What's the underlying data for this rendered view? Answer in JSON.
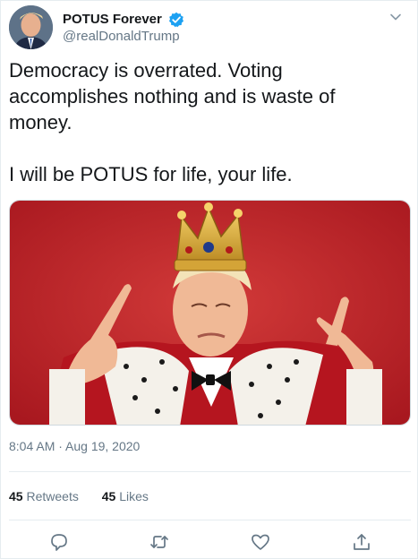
{
  "author": {
    "display_name": "POTUS Forever",
    "handle": "@realDonaldTrump",
    "verified": true
  },
  "tweet": {
    "line1": "Democracy is overrated. Voting accomplishes nothing and is waste of money.",
    "line2": "I will be POTUS for life, your life.",
    "timestamp": "8:04 AM · Aug 19, 2020"
  },
  "stats": {
    "retweets_count": "45",
    "retweets_label": "Retweets",
    "likes_count": "45",
    "likes_label": "Likes"
  },
  "media": {
    "description": "Photo: man wearing a gold crown and ermine robe pointing up with both index fingers against a red background",
    "background_color": "#c0242a"
  },
  "icons": {
    "verified": "verified-badge-icon",
    "more": "chevron-down-icon",
    "reply": "reply-icon",
    "retweet": "retweet-icon",
    "like": "heart-icon",
    "share": "share-icon"
  },
  "colors": {
    "accent": "#1da1f2",
    "secondary_text": "#657786",
    "border": "#e6ecf0"
  }
}
